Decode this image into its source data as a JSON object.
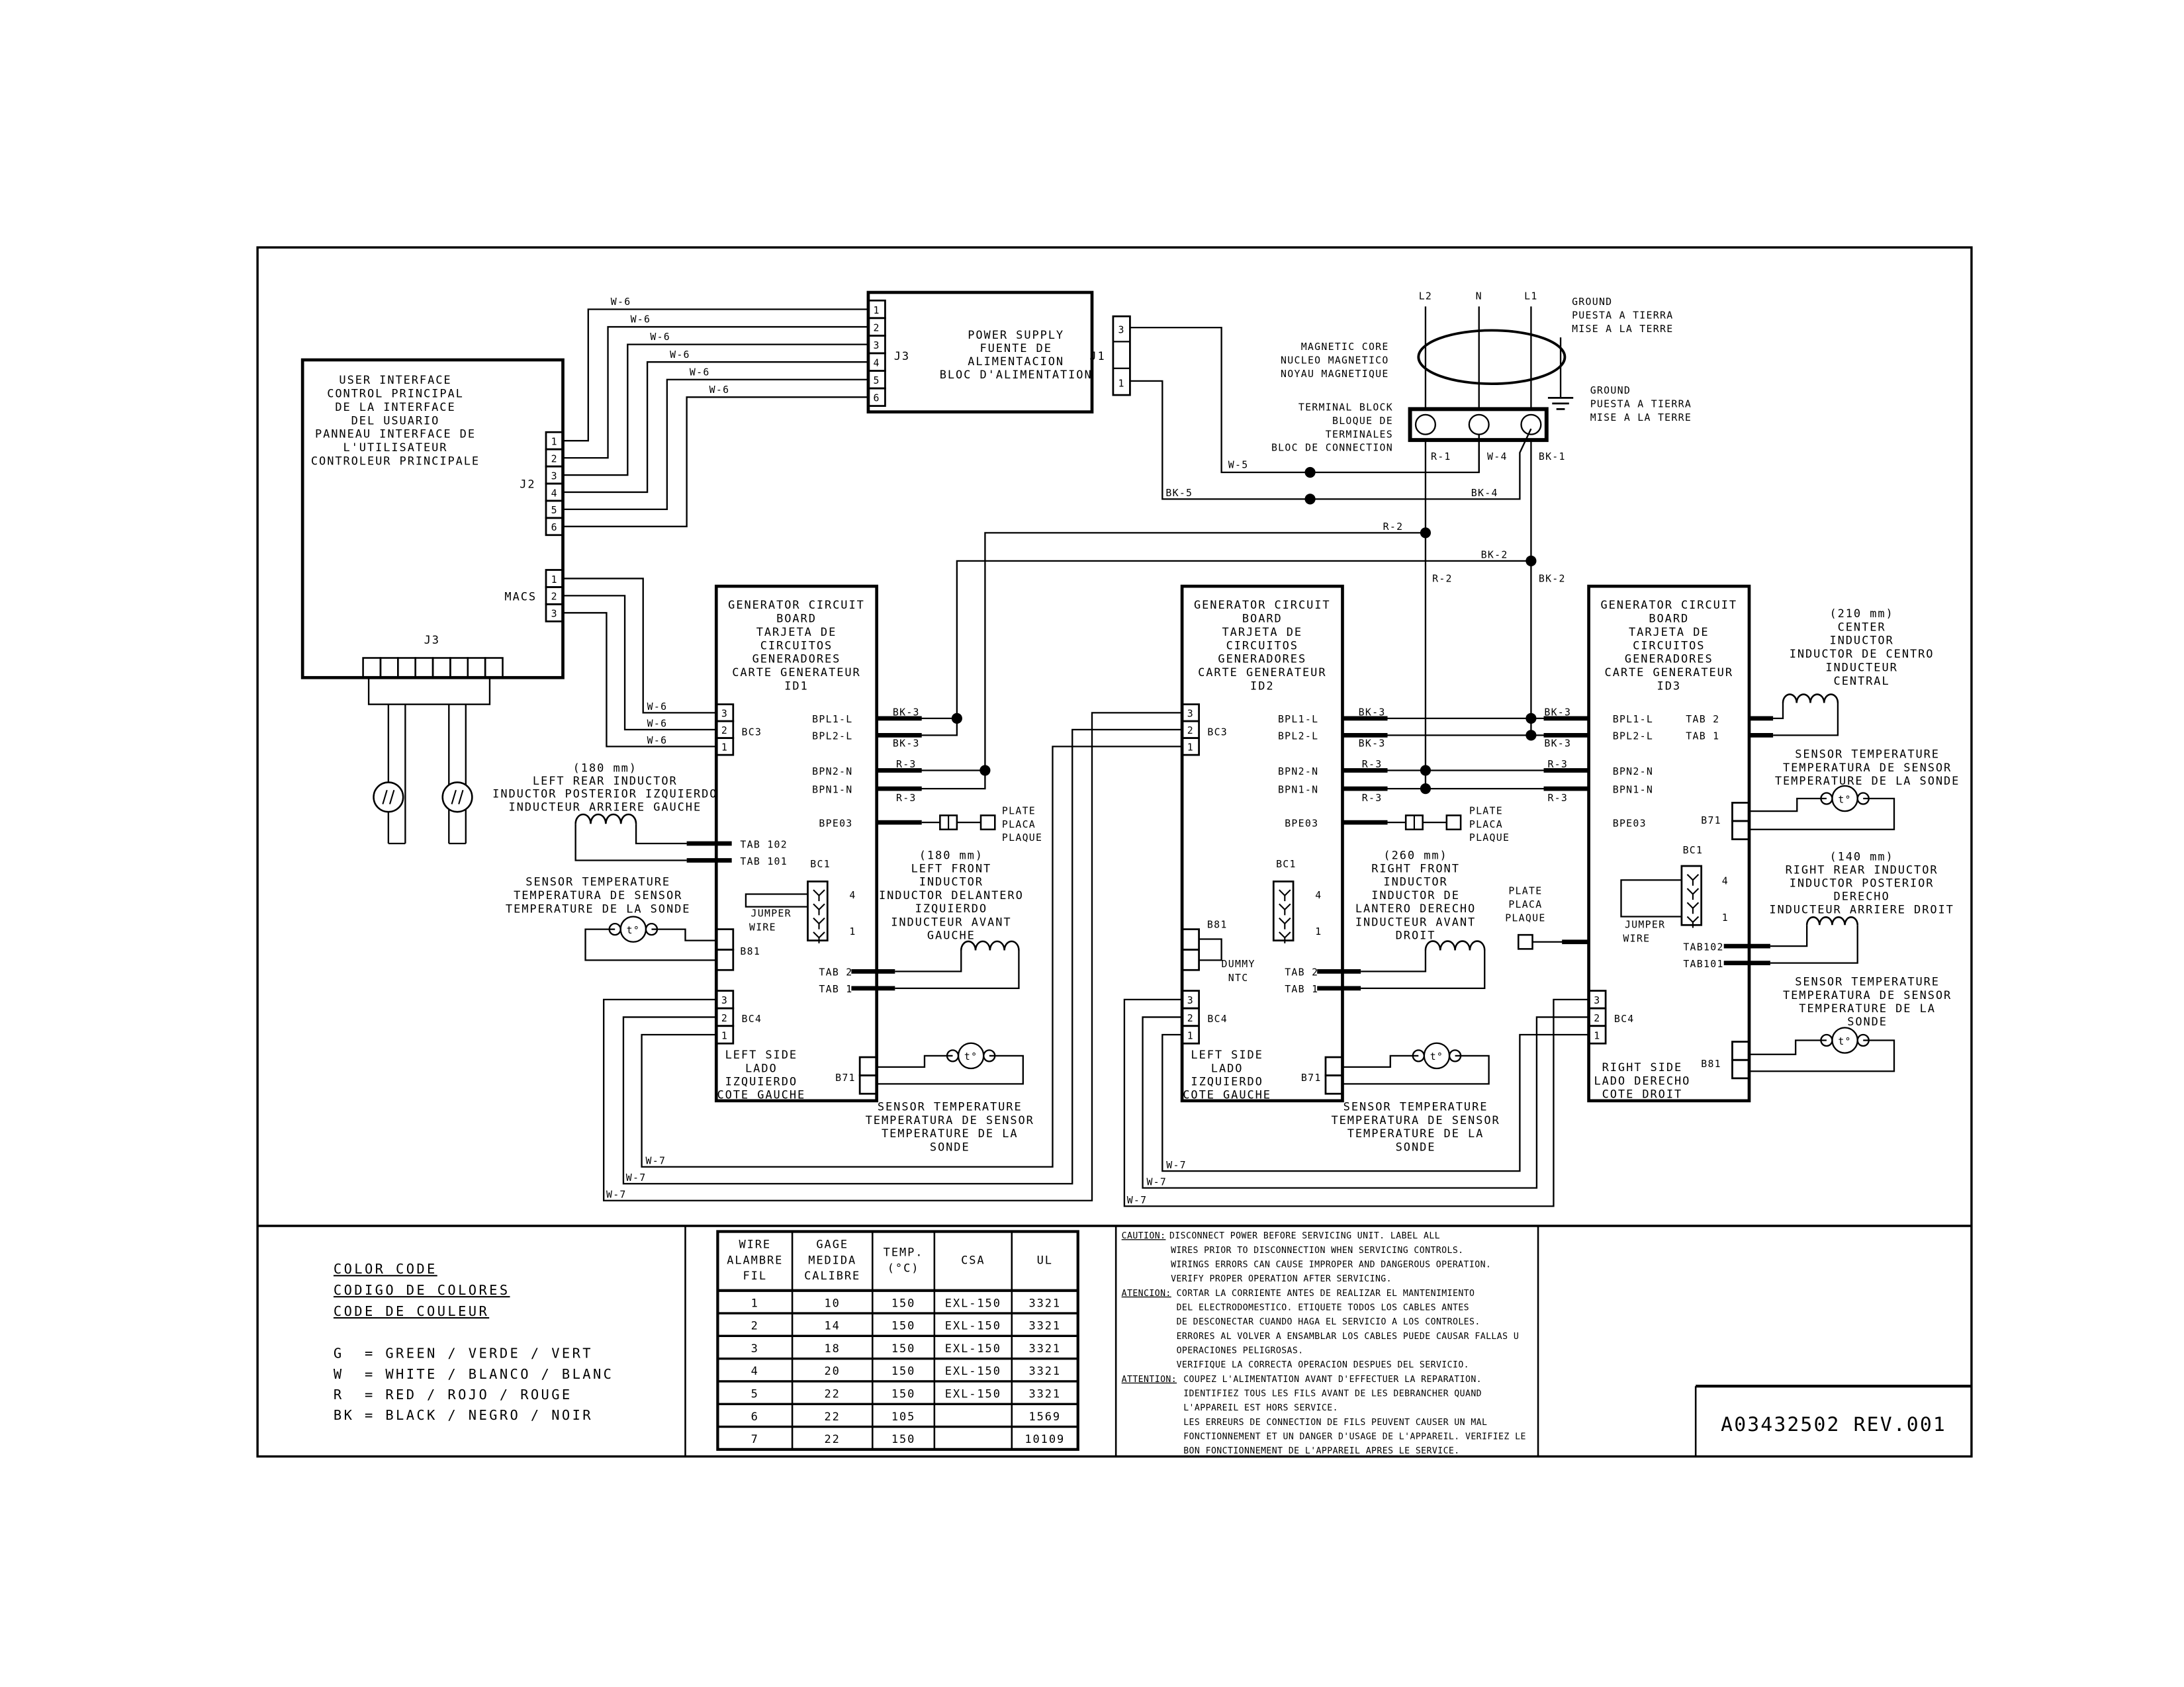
{
  "user_interface": {
    "title_lines": [
      "USER INTERFACE",
      "CONTROL PRINCIPAL",
      "DE LA INTERFACE",
      "DEL USUARIO",
      "PANNEAU INTERFACE DE",
      "L'UTILISATEUR",
      "CONTROLEUR PRINCIPALE"
    ],
    "j2_label": "J2",
    "j2_pins": [
      "1",
      "2",
      "3",
      "4",
      "5",
      "6"
    ],
    "macs_label": "MACS",
    "macs_pins": [
      "1",
      "2",
      "3"
    ],
    "j3_label": "J3"
  },
  "power_supply": {
    "title_lines": [
      "POWER SUPPLY",
      "FUENTE DE",
      "ALIMENTACION",
      "BLOC D'ALIMENTATION"
    ],
    "j3_label": "J3",
    "j3_pins": [
      "1",
      "2",
      "3",
      "4",
      "5",
      "6"
    ],
    "j1_label": "J1",
    "j1_pins": [
      "3",
      "1"
    ]
  },
  "mains": {
    "l2": "L2",
    "n": "N",
    "l1": "L1",
    "ground_top": [
      "GROUND",
      "PUESTA A TIERRA",
      "MISE A LA TERRE"
    ],
    "ground_bottom": [
      "GROUND",
      "PUESTA A TIERRA",
      "MISE A LA TERRE"
    ],
    "magnetic_core": [
      "MAGNETIC CORE",
      "NUCLEO MAGNETICO",
      "NOYAU MAGNETIQUE"
    ],
    "terminal_block": [
      "TERMINAL BLOCK",
      "BLOQUE DE",
      "TERMINALES",
      "BLOC DE CONNECTION"
    ]
  },
  "wire_labels": {
    "w6": "W-6",
    "w5": "W-5",
    "w4": "W-4",
    "w7": "W-7",
    "bk1": "BK-1",
    "bk2": "BK-2",
    "bk3": "BK-3",
    "bk4": "BK-4",
    "bk5": "BK-5",
    "r1": "R-1",
    "r2": "R-2",
    "r3": "R-3"
  },
  "board_labels": {
    "bc3": "BC3",
    "bc4": "BC4",
    "bc1": "BC1",
    "bpl1": "BPL1-L",
    "bpl2": "BPL2-L",
    "bpn2": "BPN2-N",
    "bpn1": "BPN1-N",
    "bpe03": "BPE03",
    "tab2": "TAB 2",
    "tab1": "TAB 1",
    "tab102": "TAB 102",
    "tab101": "TAB 101",
    "tab102_right": "TAB102",
    "tab101_right": "TAB101",
    "b71": "B71",
    "b81": "B81",
    "pin_1": "1",
    "pin_2": "2",
    "pin_3": "3",
    "pin_4": "4",
    "jumper_wire": [
      "JUMPER",
      "WIRE"
    ],
    "dummy_ntc": [
      "DUMMY",
      "NTC"
    ],
    "plate": [
      "PLATE",
      "PLACA",
      "PLAQUE"
    ],
    "thermistor_symbol": "t°"
  },
  "boards": [
    {
      "title_lines": [
        "GENERATOR CIRCUIT",
        "BOARD",
        "TARJETA DE",
        "CIRCUITOS",
        "GENERADORES",
        "CARTE GENERATEUR",
        "ID1"
      ],
      "side_lines": [
        "LEFT SIDE",
        "LADO",
        "IZQUIERDO",
        "COTE GAUCHE"
      ]
    },
    {
      "title_lines": [
        "GENERATOR CIRCUIT",
        "BOARD",
        "TARJETA DE",
        "CIRCUITOS",
        "GENERADORES",
        "CARTE GENERATEUR",
        "ID2"
      ],
      "side_lines": [
        "LEFT SIDE",
        "LADO",
        "IZQUIERDO",
        "COTE GAUCHE"
      ]
    },
    {
      "title_lines": [
        "GENERATOR CIRCUIT",
        "BOARD",
        "TARJETA DE",
        "CIRCUITOS",
        "GENERADORES",
        "CARTE GENERATEUR",
        "ID3"
      ],
      "side_lines": [
        "RIGHT SIDE",
        "LADO DERECHO",
        "COTE DROIT"
      ]
    }
  ],
  "inductors": {
    "left_rear": [
      "(180 mm)",
      "LEFT REAR INDUCTOR",
      "INDUCTOR POSTERIOR IZQUIERDO",
      "INDUCTEUR ARRIERE GAUCHE"
    ],
    "left_front": [
      "(180 mm)",
      "LEFT FRONT",
      "INDUCTOR",
      "INDUCTOR DELANTERO",
      "IZQUIERDO",
      "INDUCTEUR AVANT",
      "GAUCHE"
    ],
    "right_front": [
      "(260 mm)",
      "RIGHT FRONT",
      "INDUCTOR",
      "INDUCTOR DE",
      "LANTERO DERECHO",
      "INDUCTEUR AVANT",
      "DROIT"
    ],
    "center": [
      "(210 mm)",
      "CENTER",
      "INDUCTOR",
      "INDUCTOR DE CENTRO",
      "INDUCTEUR",
      "CENTRAL"
    ],
    "right_rear": [
      "(140 mm)",
      "RIGHT REAR INDUCTOR",
      "INDUCTOR POSTERIOR",
      "DERECHO",
      "INDUCTEUR ARRIERE DROIT"
    ]
  },
  "sensor_label_3": [
    "SENSOR TEMPERATURE",
    "TEMPERATURA DE SENSOR",
    "TEMPERATURE DE LA SONDE"
  ],
  "sensor_label_4": [
    "SENSOR TEMPERATURE",
    "TEMPERATURA DE SENSOR",
    "TEMPERATURE DE LA",
    "SONDE"
  ],
  "color_code": {
    "titles": [
      "COLOR CODE",
      "CODIGO DE COLORES",
      "CODE DE COULEUR"
    ],
    "entries": [
      "G  = GREEN / VERDE / VERT",
      "W  = WHITE / BLANCO / BLANC",
      "R  = RED / ROJO / ROUGE",
      "BK = BLACK / NEGRO / NOIR"
    ]
  },
  "wire_table": {
    "headers": [
      [
        "WIRE",
        "ALAMBRE",
        "FIL"
      ],
      [
        "GAGE",
        "MEDIDA",
        "CALIBRE"
      ],
      [
        "TEMP.",
        "(°C)"
      ],
      [
        "CSA"
      ],
      [
        "UL"
      ]
    ],
    "rows": [
      [
        "1",
        "10",
        "150",
        "EXL-150",
        "3321"
      ],
      [
        "2",
        "14",
        "150",
        "EXL-150",
        "3321"
      ],
      [
        "3",
        "18",
        "150",
        "EXL-150",
        "3321"
      ],
      [
        "4",
        "20",
        "150",
        "EXL-150",
        "3321"
      ],
      [
        "5",
        "22",
        "150",
        "EXL-150",
        "3321"
      ],
      [
        "6",
        "22",
        "105",
        "",
        "1569"
      ],
      [
        "7",
        "22",
        "150",
        "",
        "10109"
      ]
    ]
  },
  "caution": {
    "caution_lead": "CAUTION:",
    "caution_lines": [
      "DISCONNECT POWER BEFORE SERVICING UNIT. LABEL ALL",
      "WIRES PRIOR TO DISCONNECTION WHEN SERVICING CONTROLS.",
      "WIRINGS ERRORS CAN CAUSE IMPROPER AND DANGEROUS OPERATION.",
      "VERIFY PROPER OPERATION AFTER SERVICING."
    ],
    "atencion_lead": "ATENCION:",
    "atencion_lines": [
      "CORTAR LA CORRIENTE ANTES DE REALIZAR EL MANTENIMIENTO",
      "DEL ELECTRODOMESTICO. ETIQUETE TODOS LOS CABLES ANTES",
      "DE DESCONECTAR CUANDO HAGA EL SERVICIO A LOS CONTROLES.",
      "ERRORES AL VOLVER A ENSAMBLAR LOS CABLES PUEDE CAUSAR FALLAS U",
      "OPERACIONES PELIGROSAS.",
      "VERIFIQUE LA CORRECTA OPERACION DESPUES DEL SERVICIO."
    ],
    "attention_lead": "ATTENTION:",
    "attention_lines": [
      "COUPEZ L'ALIMENTATION AVANT D'EFFECTUER LA REPARATION.",
      "IDENTIFIEZ TOUS LES FILS AVANT DE LES DEBRANCHER QUAND",
      "L'APPAREIL EST HORS SERVICE.",
      "LES ERREURS DE CONNECTION DE FILS PEUVENT CAUSER UN MAL",
      "FONCTIONNEMENT ET UN DANGER D'USAGE DE L'APPAREIL. VERIFIEZ LE",
      "BON FONCTIONNEMENT DE L'APPAREIL APRES LE SERVICE."
    ]
  },
  "document_number": "A03432502 REV.001"
}
